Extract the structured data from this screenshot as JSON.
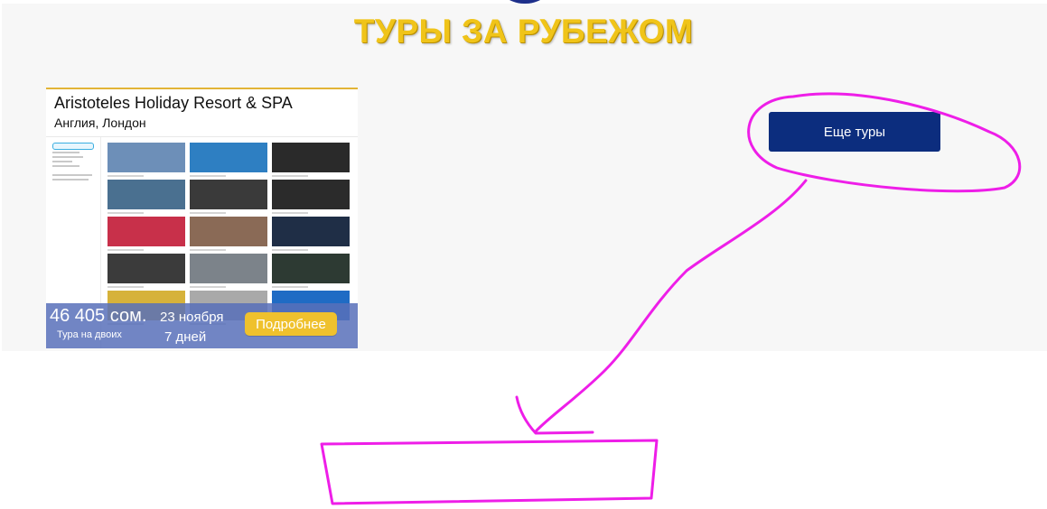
{
  "section": {
    "title": "ТУРЫ ЗА РУБЕЖОМ"
  },
  "tour_card": {
    "name": "Aristoteles Holiday Resort & SPA",
    "location": "Англия, Лондон",
    "price": "46 405 сом.",
    "price_note": "Тура на двоих",
    "date": "23 ноября",
    "duration": "7 дней",
    "details_label": "Подробнее"
  },
  "more_tours_label": "Еще туры",
  "colors": {
    "title_yellow": "#f0c419",
    "button_navy": "#0c2d7e",
    "details_yellow": "#efc12d",
    "price_bar": "#5870ba",
    "annotation_magenta": "#ee1ee8"
  },
  "thumbnail_tiles": [
    "#6d8fb8",
    "#2e7fc2",
    "#2a2a2a",
    "#4a7090",
    "#3a3a3a",
    "#2b2b2b",
    "#c8304a",
    "#8a6a56",
    "#1f2e46",
    "#3b3b3b",
    "#7c838a",
    "#2d3a33",
    "#d6b23a",
    "#a9a9a9",
    "#1f6bc4"
  ]
}
